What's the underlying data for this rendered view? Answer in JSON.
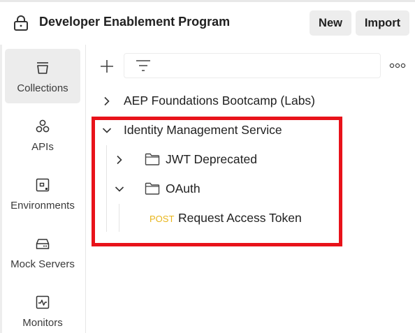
{
  "header": {
    "workspace_title": "Developer Enablement Program",
    "new_label": "New",
    "import_label": "Import"
  },
  "sidebar": {
    "items": [
      {
        "label": "Collections",
        "icon": "collections-icon",
        "active": true
      },
      {
        "label": "APIs",
        "icon": "apis-icon",
        "active": false
      },
      {
        "label": "Environments",
        "icon": "environments-icon",
        "active": false
      },
      {
        "label": "Mock Servers",
        "icon": "mock-servers-icon",
        "active": false
      },
      {
        "label": "Monitors",
        "icon": "monitors-icon",
        "active": false
      }
    ]
  },
  "tree": {
    "collections": [
      {
        "name": "AEP Foundations Bootcamp (Labs)",
        "expanded": false
      },
      {
        "name": "Identity Management Service",
        "expanded": true,
        "children": [
          {
            "type": "folder",
            "name": "JWT Deprecated",
            "expanded": false
          },
          {
            "type": "folder",
            "name": "OAuth",
            "expanded": true,
            "children": [
              {
                "type": "request",
                "method": "POST",
                "name": "Request Access Token"
              }
            ]
          }
        ]
      }
    ]
  },
  "colors": {
    "highlight_border": "#e8121a",
    "post_method": "#e8b51a",
    "active_rail_bg": "#ececec"
  }
}
